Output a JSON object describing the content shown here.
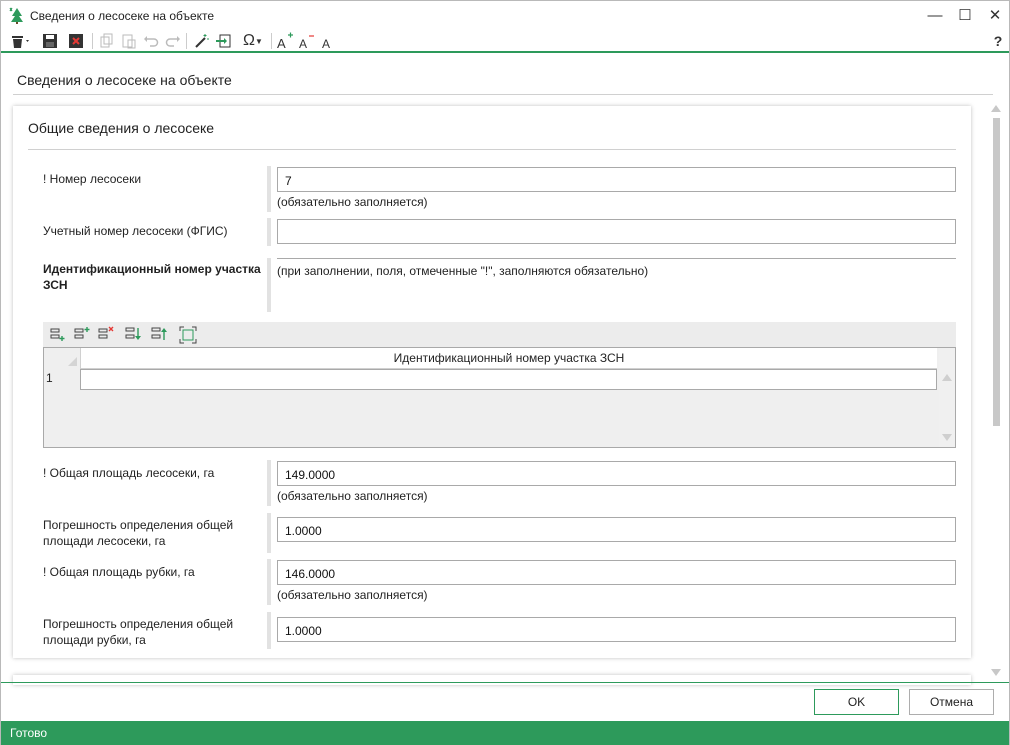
{
  "window": {
    "title": "Сведения о лесосеке на объекте",
    "minimize": "—",
    "maximize": "☐",
    "close": "✕"
  },
  "toolbar": {
    "help": "?"
  },
  "page": {
    "header": "Сведения о лесосеке на объекте"
  },
  "section": {
    "title": "Общие сведения о лесосеке"
  },
  "fields": {
    "nomer_label": "! Номер лесосеки",
    "nomer_value": "7",
    "nomer_hint": "(обязательно заполняется)",
    "uchet_label": "Учетный номер лесосеки (ФГИС)",
    "uchet_value": "",
    "ident_label": "Идентификационный номер участка ЗСН",
    "ident_hint": "(при заполнении, поля, отмеченные \"!\", заполняются обязательно)",
    "area_label": "! Общая площадь лесосеки, га",
    "area_value": "149.0000",
    "area_hint": "(обязательно заполняется)",
    "area_err_label": "Погрешность определения общей площади лесосеки, га",
    "area_err_value": "1.0000",
    "cut_label": "! Общая площадь рубки, га",
    "cut_value": "146.0000",
    "cut_hint": "(обязательно заполняется)",
    "cut_err_label": "Погрешность определения общей площади рубки, га",
    "cut_err_value": "1.0000"
  },
  "grid": {
    "column_header": "Идентификационный номер участка ЗСН",
    "row_number": "1",
    "cell_value": ""
  },
  "buttons": {
    "ok": "OK",
    "cancel": "Отмена"
  },
  "status": {
    "text": "Готово"
  },
  "colors": {
    "accent": "#2d9a5b"
  }
}
